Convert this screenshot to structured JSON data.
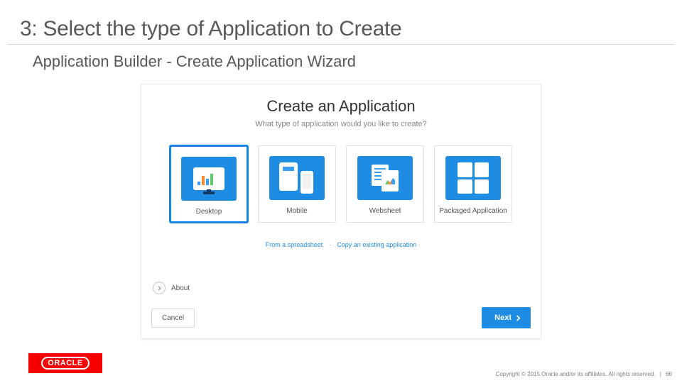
{
  "slide": {
    "title": "3: Select the type of Application to Create",
    "subtitle": "Application Builder - Create Application Wizard",
    "page_number": "66"
  },
  "builder": {
    "title": "Create an Application",
    "question": "What type of application would you like to create?",
    "cards": [
      {
        "label": "Desktop"
      },
      {
        "label": "Mobile"
      },
      {
        "label": "Websheet"
      },
      {
        "label": "Packaged Application"
      }
    ],
    "alt_links": {
      "from_spreadsheet": "From a spreadsheet",
      "copy_existing": "Copy an existing application"
    },
    "about_label": "About",
    "cancel_label": "Cancel",
    "next_label": "Next"
  },
  "footer": {
    "copyright": "Copyright © 2015 Oracle and/or its affiliates. All rights reserved.",
    "logo_text": "ORACLE"
  }
}
